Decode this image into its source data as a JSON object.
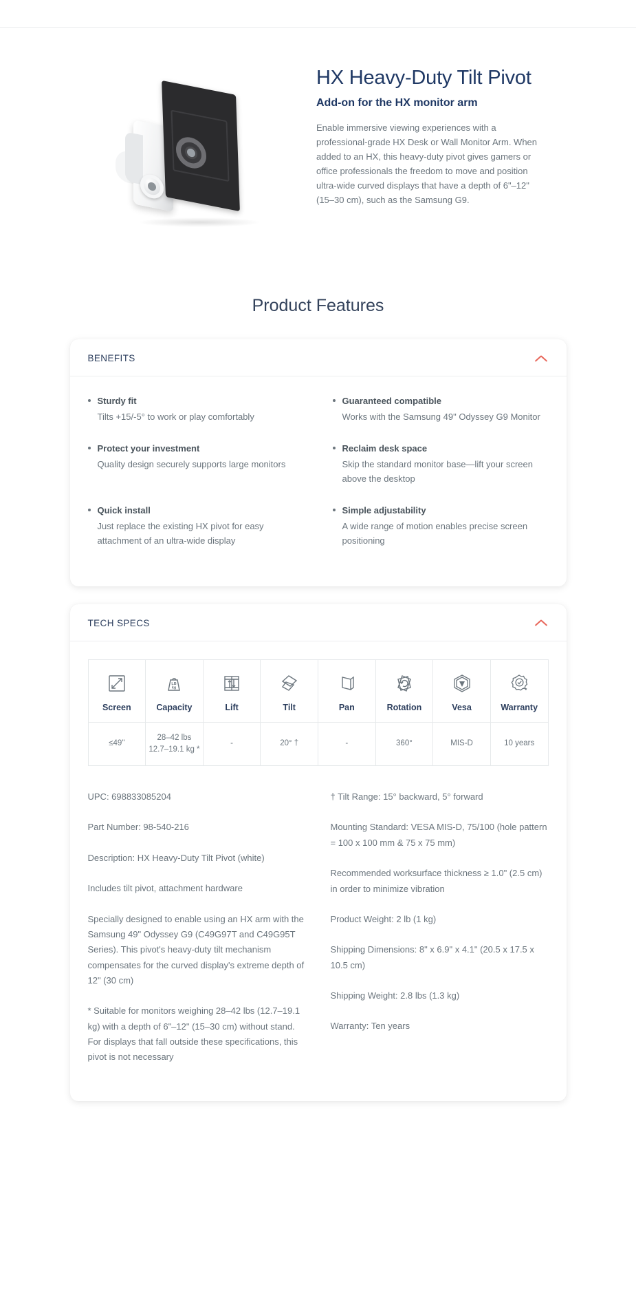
{
  "hero": {
    "title": "HX Heavy-Duty Tilt Pivot",
    "subtitle": "Add-on for the HX monitor arm",
    "description": "Enable immersive viewing experiences with a professional-grade HX Desk or Wall Monitor Arm. When added to an HX, this heavy-duty pivot gives gamers or office professionals the freedom to move and position ultra-wide curved displays that have a depth of 6\"–12\" (15–30 cm), such as the Samsung G9.",
    "product_image_alt": "hx-heavy-duty-tilt-pivot-product-image"
  },
  "section_heading": "Product Features",
  "benefits_card": {
    "title": "BENEFITS",
    "toggle_icon": "chevron-up-icon",
    "items": [
      {
        "title": "Sturdy fit",
        "desc": "Tilts +15/-5° to work or play comfortably"
      },
      {
        "title": "Guaranteed compatible",
        "desc": "Works with the Samsung 49\" Odyssey G9 Monitor"
      },
      {
        "title": "Protect your investment",
        "desc": "Quality design securely supports large monitors"
      },
      {
        "title": "Reclaim desk space",
        "desc": "Skip the standard monitor base—lift your screen above the desktop"
      },
      {
        "title": "Quick install",
        "desc": "Just replace the existing HX pivot for easy attachment of an ultra-wide display"
      },
      {
        "title": "Simple adjustability",
        "desc": "A wide range of motion enables precise screen positioning"
      }
    ]
  },
  "tech_specs_card": {
    "title": "TECH SPECS",
    "toggle_icon": "chevron-up-icon",
    "table": {
      "columns": [
        {
          "label": "Screen",
          "icon": "screen-diagonal-icon"
        },
        {
          "label": "Capacity",
          "icon": "weight-icon"
        },
        {
          "label": "Lift",
          "icon": "lift-icon"
        },
        {
          "label": "Tilt",
          "icon": "tilt-icon"
        },
        {
          "label": "Pan",
          "icon": "pan-icon"
        },
        {
          "label": "Rotation",
          "icon": "rotation-icon"
        },
        {
          "label": "Vesa",
          "icon": "vesa-icon"
        },
        {
          "label": "Warranty",
          "icon": "warranty-badge-icon"
        }
      ],
      "row": [
        "≤49\"",
        "28–42 lbs 12.7–19.1 kg *",
        "-",
        "20° †",
        "-",
        "360°",
        "MIS-D",
        "10 years"
      ]
    },
    "details_left": [
      "UPC: 698833085204",
      "Part Number: 98-540-216",
      "Description: HX Heavy-Duty Tilt Pivot (white)",
      "Includes tilt pivot, attachment hardware",
      "Specially designed to enable using an HX arm with the Samsung 49\" Odyssey G9 (C49G97T and C49G95T Series). This pivot's heavy-duty tilt mechanism compensates for the curved display's extreme depth of 12\" (30 cm)",
      "* Suitable for monitors weighing 28–42 lbs (12.7–19.1 kg) with a depth of 6\"–12\" (15–30 cm) without stand. For displays that fall outside these specifications, this pivot is not necessary"
    ],
    "details_right": [
      "† Tilt Range: 15° backward, 5° forward",
      "Mounting Standard: VESA MIS-D, 75/100 (hole pattern = 100 x 100 mm & 75 x 75 mm)",
      "Recommended worksurface thickness ≥ 1.0\" (2.5 cm) in order to minimize vibration",
      "Product Weight: 2 lb (1 kg)",
      "Shipping Dimensions: 8\" x 6.9\" x 4.1\" (20.5 x 17.5 x 10.5 cm)",
      "Shipping Weight: 2.8 lbs (1.3 kg)",
      "Warranty: Ten years"
    ]
  },
  "colors": {
    "heading_navy": "#1f3864",
    "body_gray": "#6b757d",
    "accent_red": "#e8665a",
    "spec_label_navy": "#2c3e5d"
  }
}
